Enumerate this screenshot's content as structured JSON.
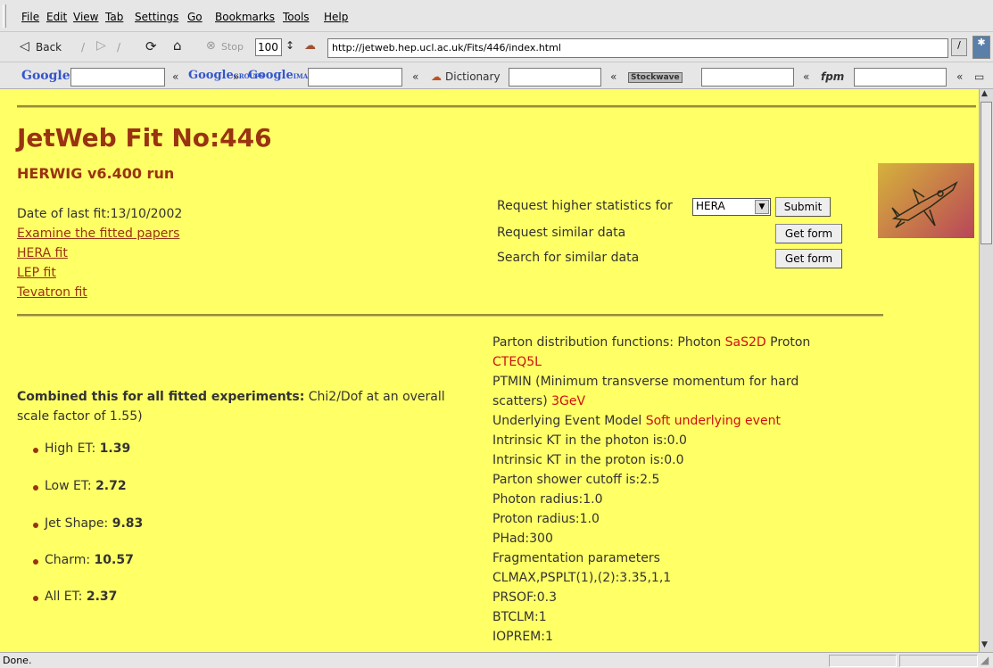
{
  "menu": [
    "File",
    "Edit",
    "View",
    "Tab",
    "Settings",
    "Go",
    "Bookmarks",
    "Tools",
    "Help"
  ],
  "nav": {
    "back_label": "Back",
    "stop_label": "Stop",
    "zoom": "100",
    "url": "http://jetweb.hep.ucl.ac.uk/Fits/446/index.html"
  },
  "google_bar": {
    "logo": "Google",
    "groups_logo": "Google",
    "groups_sub": "GROUPS",
    "images_logo": "Google",
    "images_sub": "IMAGES",
    "dictionary_label": "Dictionary",
    "stockwave_label": "Stockwave",
    "fpm_label": "fpm",
    "nav_left": "«",
    "nav_right": "»"
  },
  "page": {
    "title": "JetWeb Fit No:446",
    "subtitle": "HERWIG v6.400 run",
    "date_of_last_fit": "Date of last fit:13/10/2002",
    "links": [
      "Examine the fitted papers",
      "HERA fit",
      "LEP fit",
      "Tevatron fit"
    ],
    "request_higher_label": "Request higher statistics for",
    "experiment_select": "HERA",
    "submit_label": "Submit",
    "request_similar_label": "Request similar data",
    "search_similar_label": "Search for similar data",
    "get_form_label": "Get form",
    "combined_bold": "Combined this for all fitted experiments:",
    "combined_rest": "Chi2/Dof at an overall scale factor of 1.55)",
    "results": [
      {
        "label": "High ET:",
        "value": "1.39"
      },
      {
        "label": "Low ET:",
        "value": "2.72"
      },
      {
        "label": "Jet Shape:",
        "value": "9.83"
      },
      {
        "label": "Charm:",
        "value": "10.57"
      },
      {
        "label": "All ET:",
        "value": "2.37"
      }
    ],
    "params": {
      "pdf_prefix": "Parton distribution functions: Photon",
      "pdf_photon": "SaS2D",
      "pdf_proton_label": "Proton",
      "pdf_proton": "CTEQ5L",
      "ptmin_line1": "PTMIN (Minimum transverse momentum for hard",
      "ptmin_line2": "scatters)",
      "ptmin_value": "3GeV",
      "ue_label": "Underlying Event Model",
      "ue_value": "Soft underlying event",
      "lines": [
        "Intrinsic KT in the photon is:0.0",
        "Intrinsic KT in the proton is:0.0",
        "Parton shower cutoff is:2.5",
        "Photon radius:1.0",
        "Proton radius:1.0",
        "PHad:300",
        "Fragmentation parameters",
        "CLMAX,PSPLT(1),(2):3.35,1,1",
        "PRSOF:0.3",
        "BTCLM:1",
        "IOPREM:1"
      ]
    }
  },
  "status": "Done.",
  "colors": {
    "page_bg": "#ffff66",
    "heading": "#993311",
    "highlight": "#cc1111"
  }
}
